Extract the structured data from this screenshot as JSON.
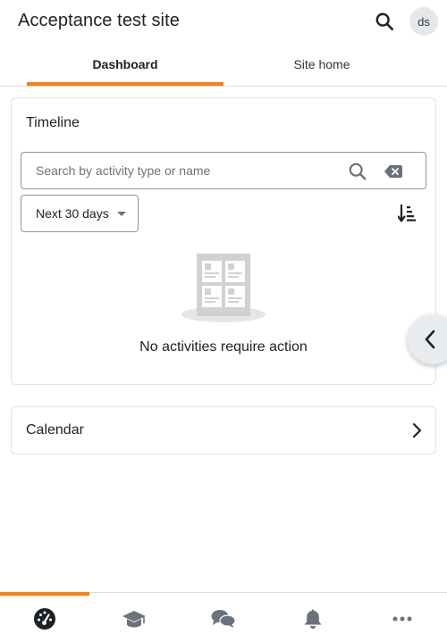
{
  "header": {
    "site_title": "Acceptance test site",
    "avatar_initials": "ds"
  },
  "tabs": [
    {
      "label": "Dashboard",
      "active": true
    },
    {
      "label": "Site home",
      "active": false
    }
  ],
  "timeline": {
    "title": "Timeline",
    "search": {
      "value": "",
      "placeholder": "Search by activity type or name"
    },
    "filter": {
      "selected": "Next 30 days"
    },
    "empty_message": "No activities require action"
  },
  "calendar": {
    "title": "Calendar"
  },
  "bottom_nav": {
    "items": [
      {
        "icon": "dashboard-icon",
        "active": true
      },
      {
        "icon": "graduation-cap-icon",
        "active": false
      },
      {
        "icon": "chat-bubbles-icon",
        "active": false
      },
      {
        "icon": "bell-icon",
        "active": false
      },
      {
        "icon": "more-icon",
        "active": false
      }
    ]
  },
  "colors": {
    "accent": "#f98012",
    "text": "#1d2125",
    "border": "#dee2e6",
    "icon": "#6a737b"
  }
}
